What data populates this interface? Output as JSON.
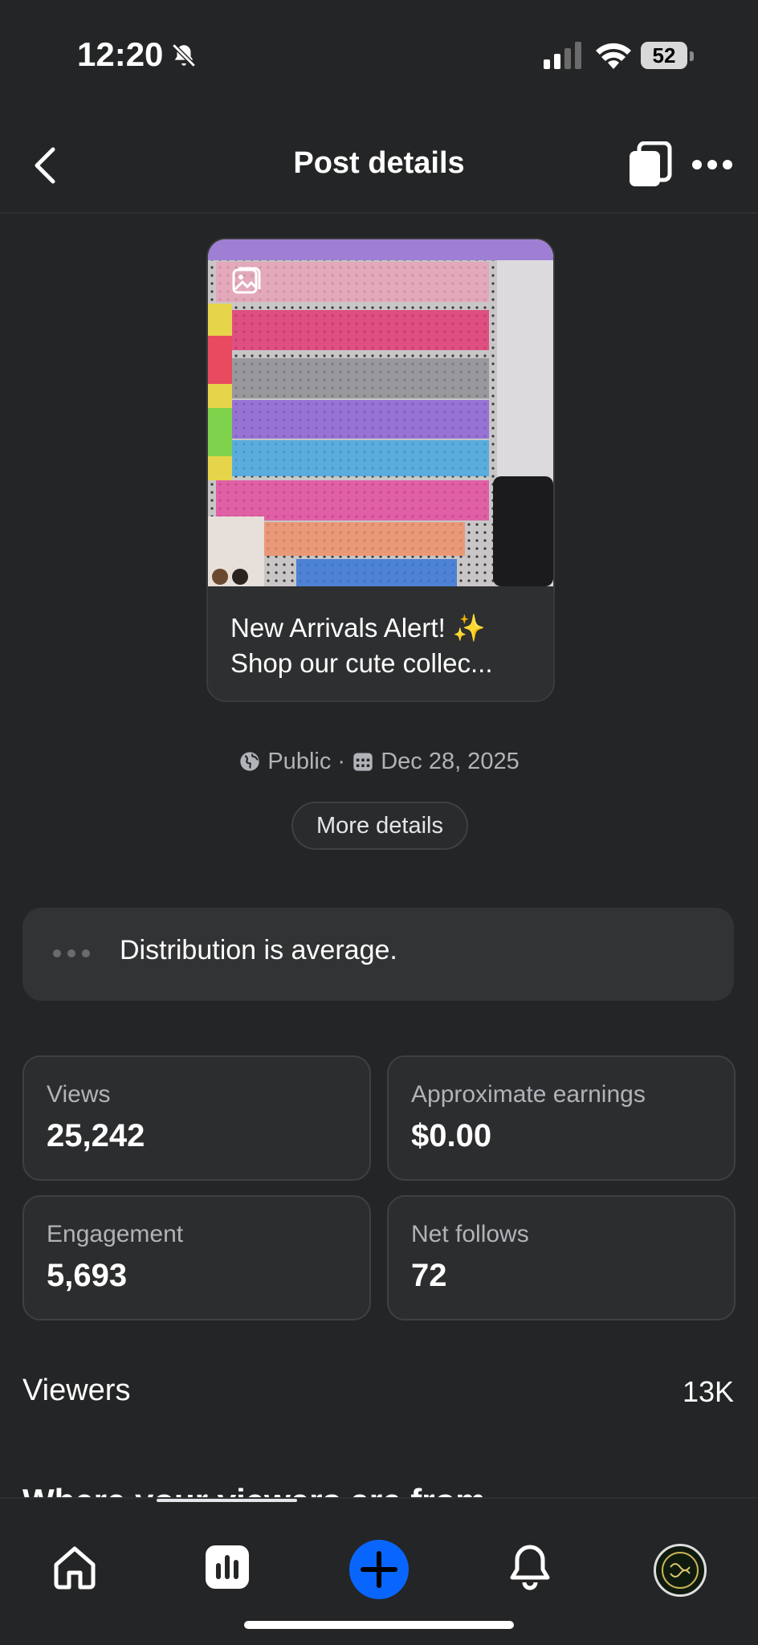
{
  "status_bar": {
    "time": "12:20",
    "battery": "52"
  },
  "header": {
    "title": "Post details"
  },
  "post": {
    "caption_line1": "New Arrivals Alert! ✨",
    "caption_line2": "Shop our cute collec...",
    "audience": "Public",
    "date": "Dec 28, 2025",
    "more_details_label": "More details"
  },
  "distribution": {
    "text": "Distribution is average."
  },
  "stats": [
    {
      "label": "Views",
      "value": "25,242"
    },
    {
      "label": "Approximate earnings",
      "value": "$0.00"
    },
    {
      "label": "Engagement",
      "value": "5,693"
    },
    {
      "label": "Net follows",
      "value": "72"
    }
  ],
  "viewers": {
    "label": "Viewers",
    "count": "13K"
  },
  "cut_off_heading": "Where your viewers are from",
  "nav": {
    "items": [
      "home-icon",
      "stats-icon",
      "add-icon",
      "bell-icon",
      "profile-avatar"
    ],
    "active": "stats-icon"
  },
  "colors": {
    "background": "#242526",
    "card": "#2e2f30",
    "accent": "#0866ff"
  }
}
